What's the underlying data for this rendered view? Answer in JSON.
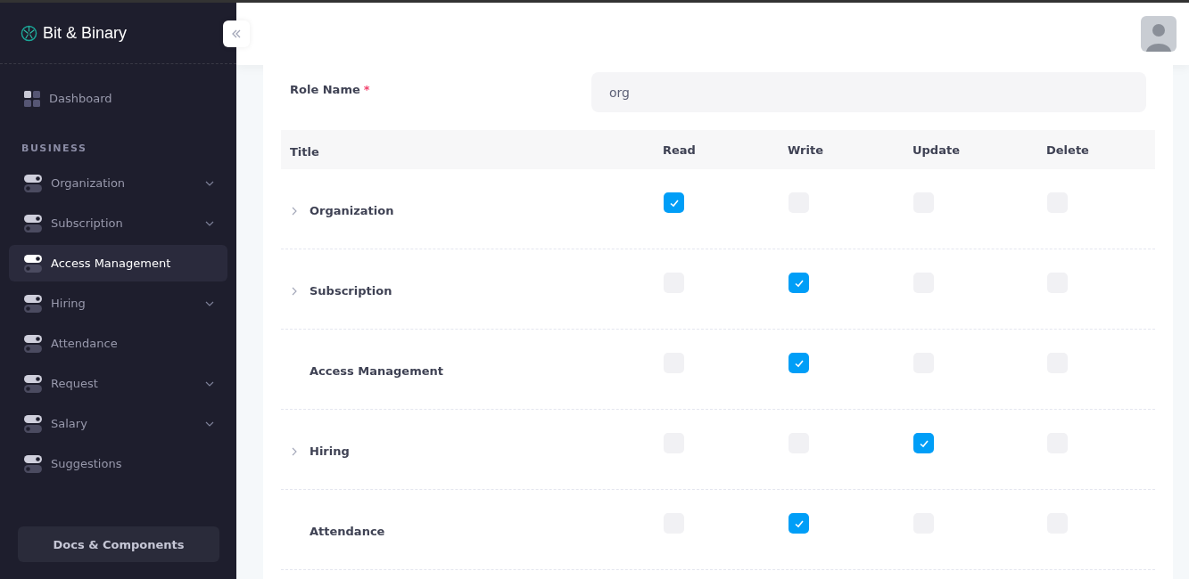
{
  "sidebar": {
    "brand": "Bit & Binary",
    "items": [
      {
        "label": "Dashboard",
        "kind": "dashboard",
        "selected": false
      }
    ],
    "section": "BUSINESS",
    "business_items": [
      {
        "label": "Organization",
        "expandable": true,
        "selected": false
      },
      {
        "label": "Subscription",
        "expandable": true,
        "selected": false
      },
      {
        "label": "Access Management",
        "expandable": false,
        "selected": true
      },
      {
        "label": "Hiring",
        "expandable": true,
        "selected": false
      },
      {
        "label": "Attendance",
        "expandable": false,
        "selected": false
      },
      {
        "label": "Request",
        "expandable": true,
        "selected": false
      },
      {
        "label": "Salary",
        "expandable": true,
        "selected": false
      },
      {
        "label": "Suggestions",
        "expandable": false,
        "selected": false
      }
    ],
    "footer_button": "Docs & Components"
  },
  "form": {
    "label": "Role Name",
    "required_mark": "*",
    "value": "org"
  },
  "table": {
    "columns": [
      "Title",
      "Read",
      "Write",
      "Update",
      "Delete"
    ],
    "rows": [
      {
        "title": "Organization",
        "expandable": true,
        "read": true,
        "write": false,
        "update": false,
        "delete": false
      },
      {
        "title": "Subscription",
        "expandable": true,
        "read": false,
        "write": true,
        "update": false,
        "delete": false
      },
      {
        "title": "Access Management",
        "expandable": false,
        "read": false,
        "write": true,
        "update": false,
        "delete": false
      },
      {
        "title": "Hiring",
        "expandable": true,
        "read": false,
        "write": false,
        "update": true,
        "delete": false
      },
      {
        "title": "Attendance",
        "expandable": false,
        "read": false,
        "write": true,
        "update": false,
        "delete": false
      }
    ]
  }
}
